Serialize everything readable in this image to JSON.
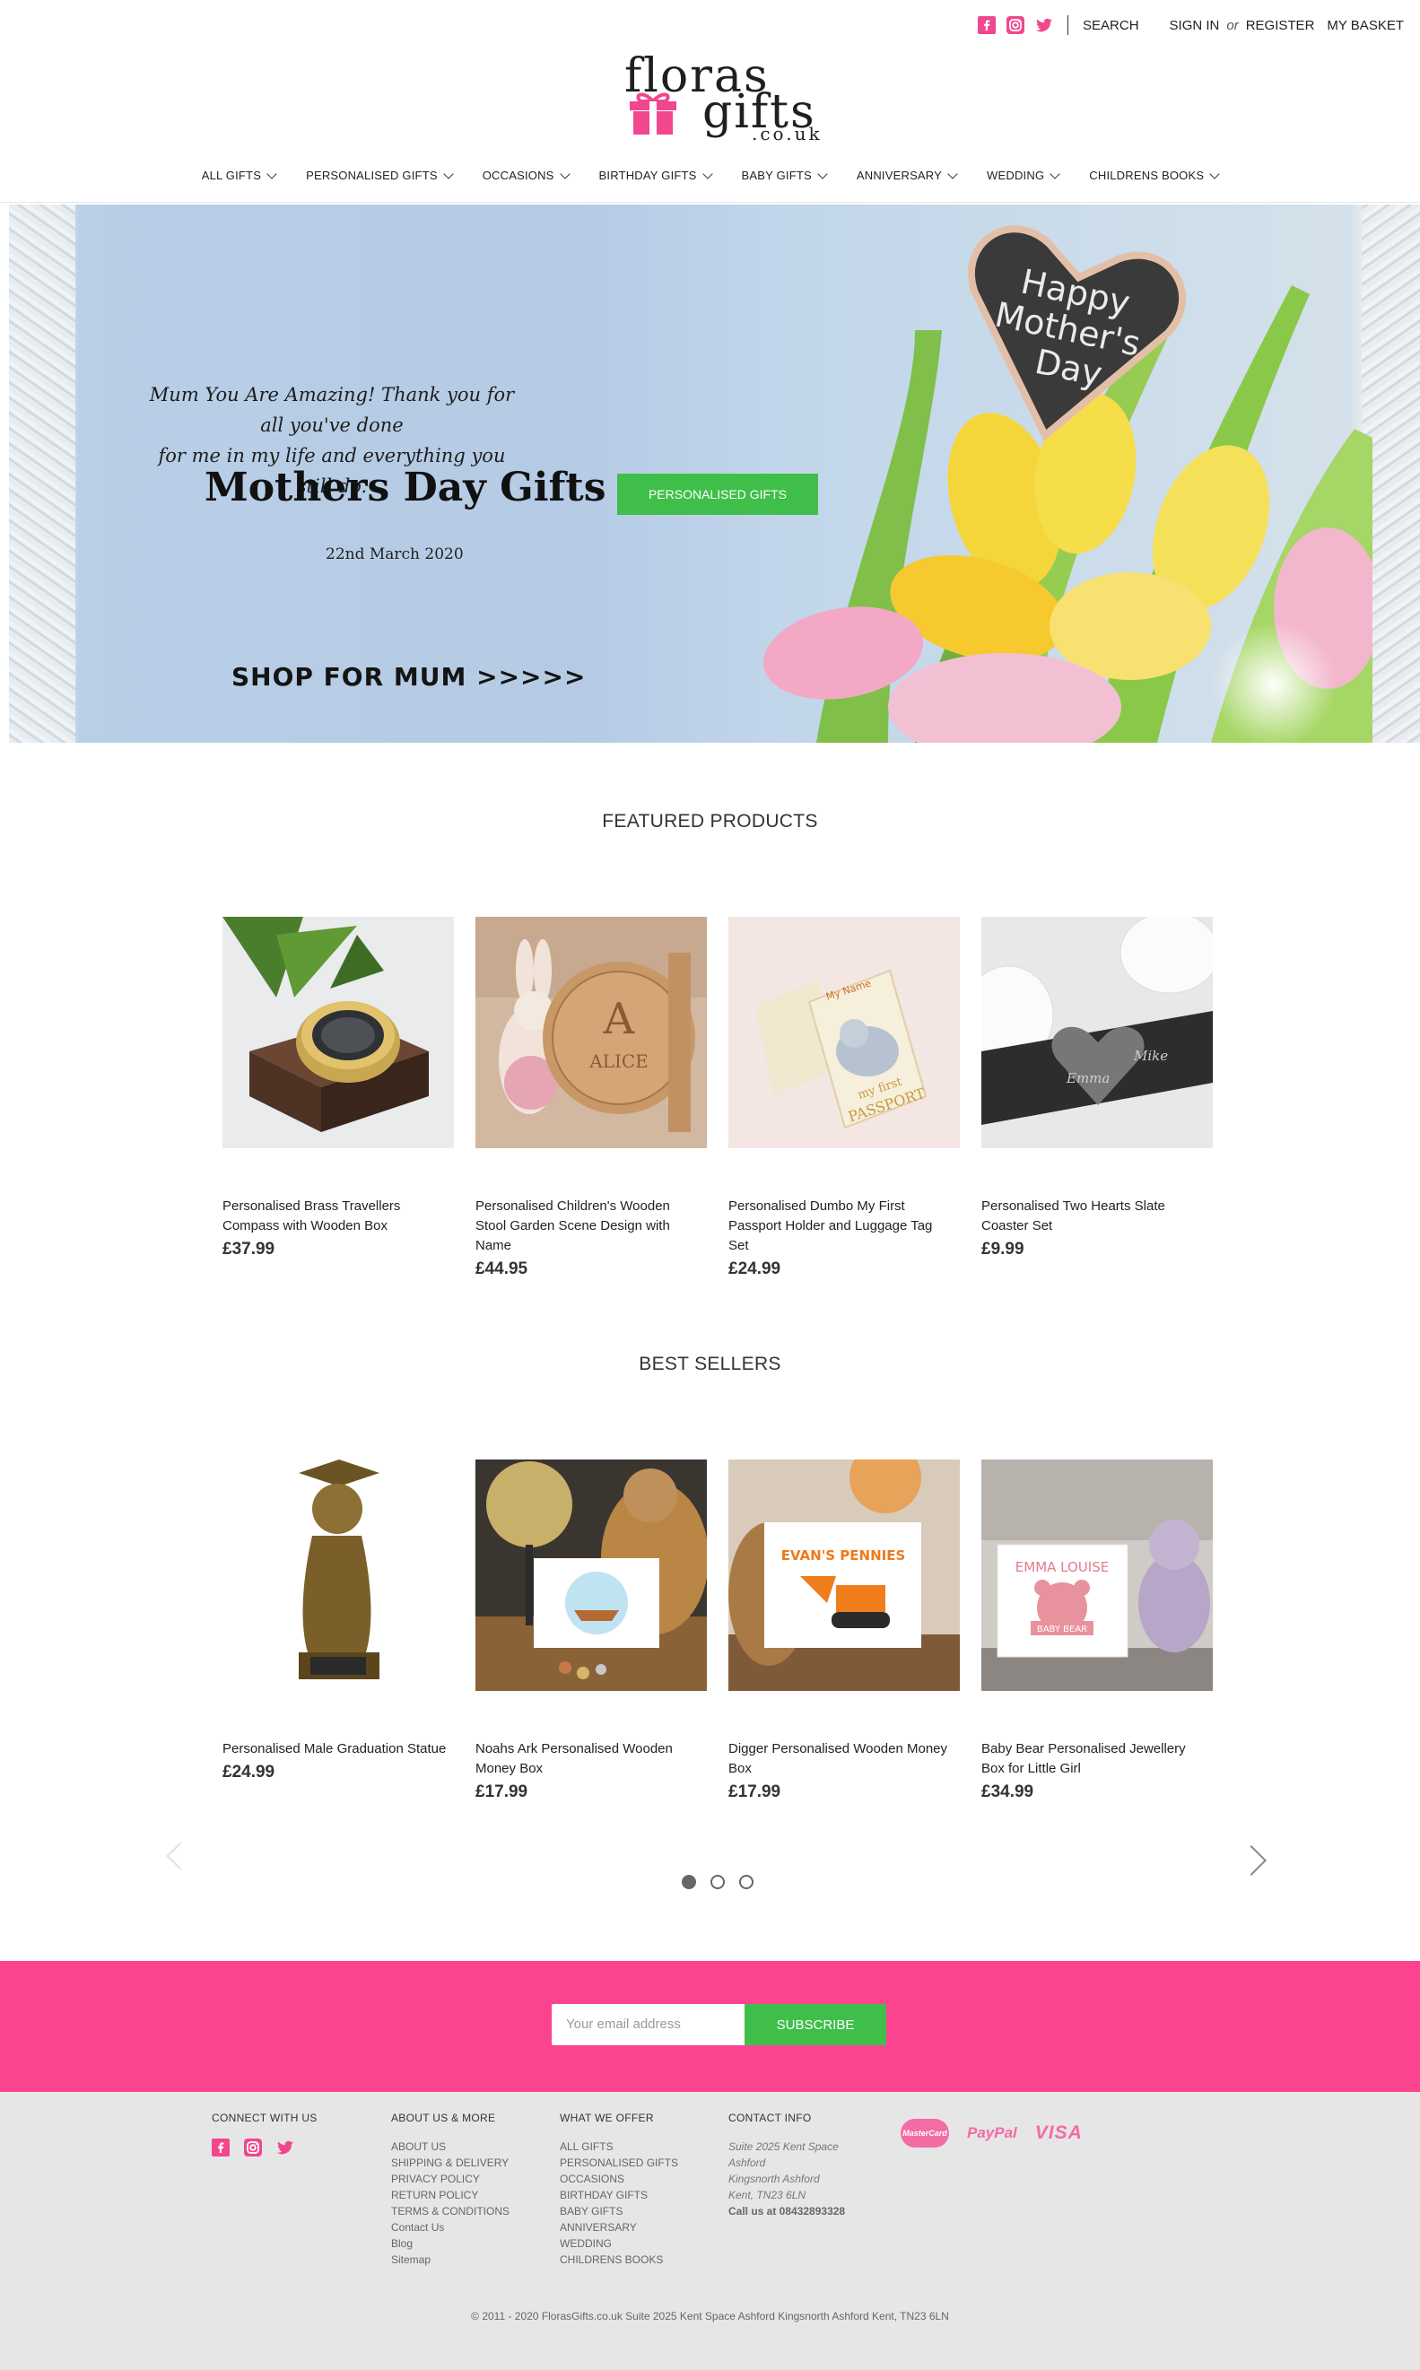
{
  "header": {
    "social": [
      "facebook-icon",
      "instagram-icon",
      "twitter-icon"
    ],
    "search_label": "SEARCH",
    "sign_in_label": "SIGN IN",
    "or_label": "or",
    "register_label": "REGISTER",
    "basket_label": "MY BASKET"
  },
  "logo": {
    "line1": "floras",
    "line2": "gifts",
    "line3": ".co.uk"
  },
  "nav": {
    "items": [
      {
        "label": "ALL GIFTS"
      },
      {
        "label": "PERSONALISED GIFTS"
      },
      {
        "label": "OCCASIONS"
      },
      {
        "label": "BIRTHDAY GIFTS"
      },
      {
        "label": "BABY GIFTS"
      },
      {
        "label": "ANNIVERSARY"
      },
      {
        "label": "WEDDING"
      },
      {
        "label": "CHILDRENS BOOKS"
      }
    ]
  },
  "hero": {
    "quote_line1": "Mum You Are Amazing! Thank you for all you've done",
    "quote_line2": "for me in my life and everything you still do.",
    "title": "Mothers Day Gifts",
    "date": "22nd March 2020",
    "shop": "SHOP FOR MUM >>>>>",
    "cta": "PERSONALISED GIFTS",
    "sign_line1": "Happy",
    "sign_line2": "Mother's",
    "sign_line3": "Day"
  },
  "featured": {
    "title": "FEATURED PRODUCTS",
    "products": [
      {
        "name": "Personalised Brass Travellers Compass with Wooden Box",
        "price": "£37.99"
      },
      {
        "name": "Personalised Children's Wooden Stool Garden Scene Design with Name",
        "price": "£44.95"
      },
      {
        "name": "Personalised Dumbo My First Passport Holder and Luggage Tag Set",
        "price": "£24.99"
      },
      {
        "name": "Personalised Two Hearts Slate Coaster Set",
        "price": "£9.99"
      }
    ]
  },
  "bestsellers": {
    "title": "BEST SELLERS",
    "products": [
      {
        "name": "Personalised Male Graduation Statue",
        "price": "£24.99"
      },
      {
        "name": "Noahs Ark Personalised Wooden Money Box",
        "price": "£17.99"
      },
      {
        "name": "Digger Personalised Wooden Money Box",
        "price": "£17.99"
      },
      {
        "name": "Baby Bear Personalised Jewellery Box for Little Girl",
        "price": "£34.99"
      }
    ],
    "image_text": {
      "stool_letter": "A",
      "stool_name": "ALICE",
      "passport_name": "My Name",
      "passport_line1": "my first",
      "passport_line2": "PASSPORT",
      "coaster_name1": "Emma",
      "coaster_name2": "Mike",
      "digger_text": "EVAN'S PENNIES",
      "bear_name": "EMMA LOUISE",
      "bear_label": "BABY BEAR"
    }
  },
  "newsletter": {
    "placeholder": "Your email address",
    "button": "SUBSCRIBE"
  },
  "footer": {
    "connect_title": "CONNECT WITH US",
    "about_title": "ABOUT US & MORE",
    "about_links": [
      "ABOUT US",
      "SHIPPING & DELIVERY",
      "PRIVACY POLICY",
      "RETURN POLICY",
      "TERMS & CONDITIONS",
      "Contact Us",
      "Blog",
      "Sitemap"
    ],
    "offer_title": "WHAT WE OFFER",
    "offer_links": [
      "ALL GIFTS",
      "PERSONALISED GIFTS",
      "OCCASIONS",
      "BIRTHDAY GIFTS",
      "BABY GIFTS",
      "ANNIVERSARY",
      "WEDDING",
      "CHILDRENS BOOKS"
    ],
    "contact_title": "CONTACT INFO",
    "address": [
      "Suite 2025 Kent Space",
      "Ashford",
      "Kingsnorth Ashford",
      "Kent, TN23 6LN"
    ],
    "call": "Call us at 08432893328",
    "payments": {
      "mastercard": "MasterCard",
      "paypal": "PayPal",
      "visa": "VISA"
    },
    "copyright": "© 2011 - 2020 FlorasGifts.co.uk Suite 2025 Kent Space Ashford Kingsnorth Ashford Kent, TN23 6LN"
  },
  "colors": {
    "brand_pink": "#fb4390",
    "cta_green": "#3fbf4a",
    "footer_bg": "#e6e6e6"
  }
}
